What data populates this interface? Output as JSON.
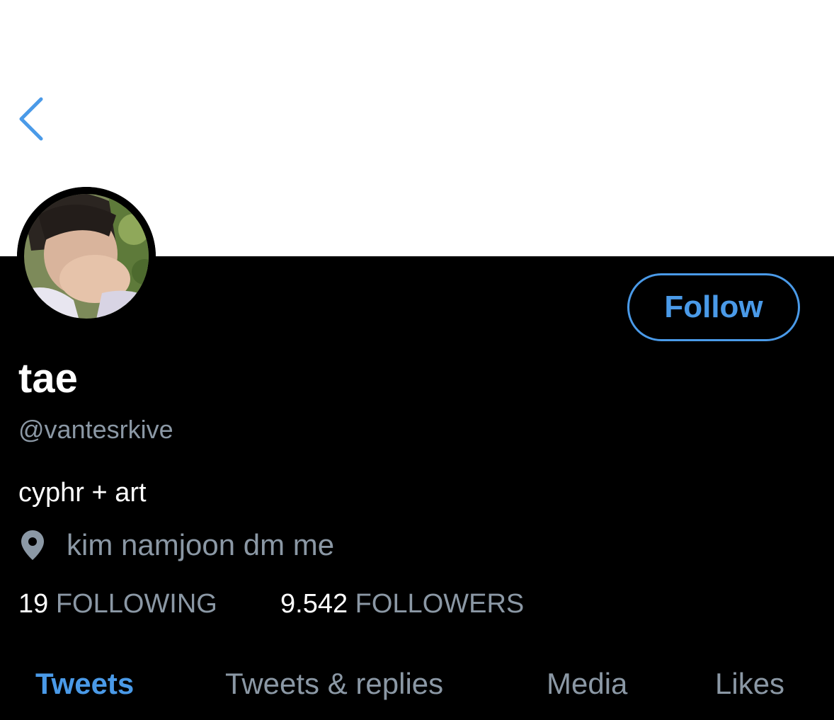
{
  "colors": {
    "accent": "#4a9ae8",
    "muted_text": "#8b98a5",
    "primary_text": "#ffffff",
    "background": "#000000",
    "banner": "#ffffff"
  },
  "header": {
    "back_icon": "chevron-left-icon"
  },
  "profile": {
    "display_name": "tae",
    "handle": "@vantesrkive",
    "bio": "cyphr + art",
    "location_icon": "location-pin-icon",
    "location": "kim namjoon dm me",
    "follow_label": "Follow",
    "following_count": "19",
    "following_label": "FOLLOWING",
    "followers_count": "9.542",
    "followers_label": "FOLLOWERS"
  },
  "tabs": [
    {
      "label": "Tweets",
      "active": true
    },
    {
      "label": "Tweets & replies",
      "active": false
    },
    {
      "label": "Media",
      "active": false
    },
    {
      "label": "Likes",
      "active": false
    }
  ]
}
